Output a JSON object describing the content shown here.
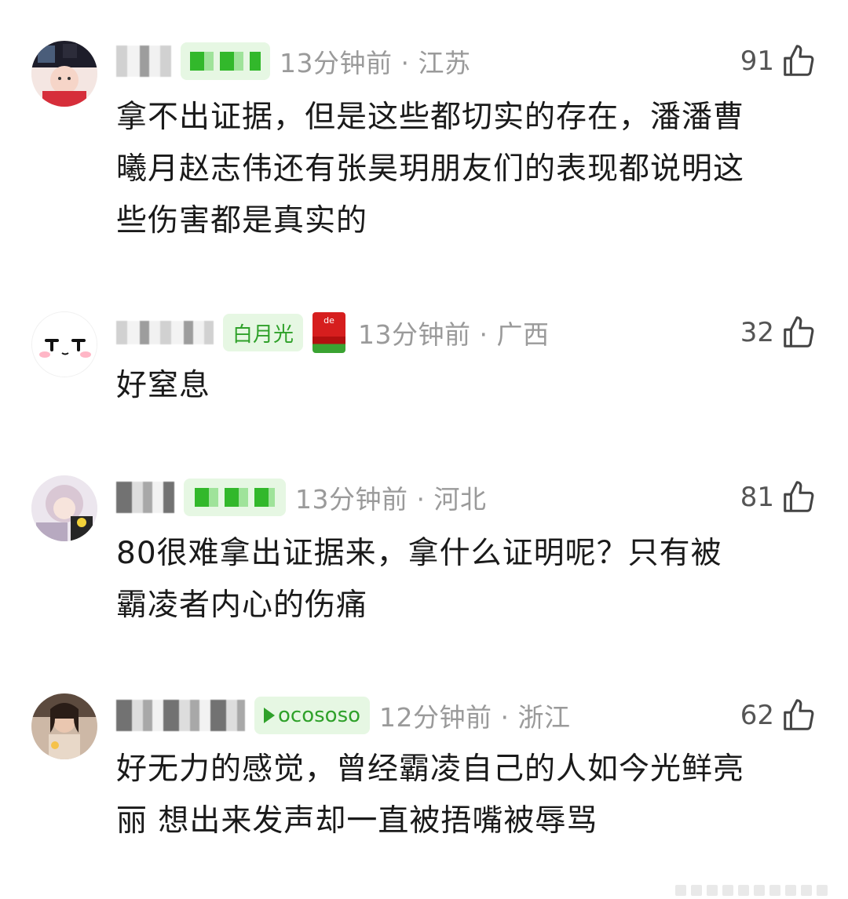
{
  "comments": [
    {
      "time_location": "13分钟前 · 江苏",
      "likes": "91",
      "lines": [
        "拿不出证据，但是这些都切实的存在，潘潘曹",
        "曦月赵志伟还有张昊玥朋友们的表现都说明这",
        "些伤害都是真实的"
      ]
    },
    {
      "badge_text": "白月光",
      "dict_icon_text": "de",
      "time_location": "13分钟前 · 广西",
      "likes": "32",
      "lines": [
        "好窒息"
      ]
    },
    {
      "time_location": "13分钟前 · 河北",
      "likes": "81",
      "lines": [
        "80很难拿出证据来，拿什么证明呢？只有被",
        "霸凌者内心的伤痛"
      ]
    },
    {
      "badge_text": "ocososo",
      "time_location": "12分钟前 · 浙江",
      "likes": "62",
      "lines": [
        "好无力的感觉，曾经霸凌自己的人如今光鲜亮",
        "丽 想出来发声却一直被捂嘴被辱骂"
      ]
    }
  ],
  "icons": {
    "like": "thumbs-up-icon"
  },
  "colors": {
    "badge_green": "#2fa12a",
    "badge_bg": "#e6f7e3",
    "meta_gray": "#9a9a9a"
  }
}
